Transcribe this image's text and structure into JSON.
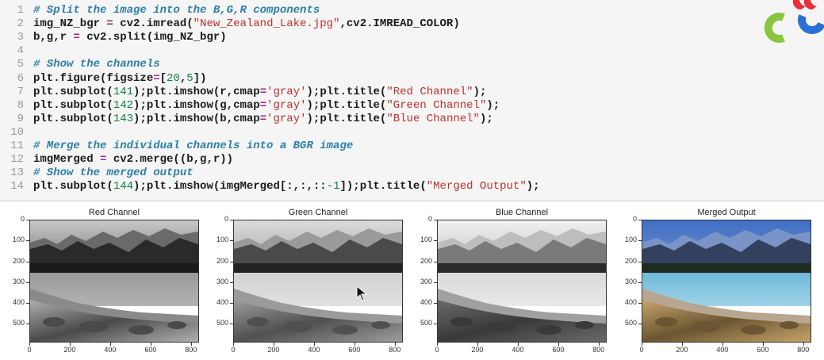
{
  "code_cell": {
    "lines": [
      {
        "n": "1",
        "tokens": [
          {
            "t": "# Split the image into the B,G,R components",
            "c": "comment"
          }
        ]
      },
      {
        "n": "2",
        "tokens": [
          {
            "t": "img_NZ_bgr ",
            "c": "ident"
          },
          {
            "t": "=",
            "c": "op"
          },
          {
            "t": " cv2.imread(",
            "c": "ident"
          },
          {
            "t": "\"New_Zealand_Lake.jpg\"",
            "c": "str"
          },
          {
            "t": ",cv2.IMREAD_COLOR)",
            "c": "ident"
          }
        ]
      },
      {
        "n": "3",
        "tokens": [
          {
            "t": "b,g,r ",
            "c": "ident"
          },
          {
            "t": "=",
            "c": "op"
          },
          {
            "t": " cv2.split(img_NZ_bgr)",
            "c": "ident"
          }
        ]
      },
      {
        "n": "4",
        "tokens": []
      },
      {
        "n": "5",
        "tokens": [
          {
            "t": "# Show the channels",
            "c": "comment"
          }
        ]
      },
      {
        "n": "6",
        "tokens": [
          {
            "t": "plt.figure(figsize",
            "c": "ident"
          },
          {
            "t": "=",
            "c": "op"
          },
          {
            "t": "[",
            "c": "ident"
          },
          {
            "t": "20",
            "c": "num"
          },
          {
            "t": ",",
            "c": "ident"
          },
          {
            "t": "5",
            "c": "num"
          },
          {
            "t": "])",
            "c": "ident"
          }
        ]
      },
      {
        "n": "7",
        "tokens": [
          {
            "t": "plt.subplot(",
            "c": "ident"
          },
          {
            "t": "141",
            "c": "num"
          },
          {
            "t": ");plt.imshow(r,cmap",
            "c": "ident"
          },
          {
            "t": "=",
            "c": "op"
          },
          {
            "t": "'gray'",
            "c": "str"
          },
          {
            "t": ");plt.title(",
            "c": "ident"
          },
          {
            "t": "\"Red Channel\"",
            "c": "str"
          },
          {
            "t": ");",
            "c": "ident"
          }
        ]
      },
      {
        "n": "8",
        "tokens": [
          {
            "t": "plt.subplot(",
            "c": "ident"
          },
          {
            "t": "142",
            "c": "num"
          },
          {
            "t": ");plt.imshow(g,cmap",
            "c": "ident"
          },
          {
            "t": "=",
            "c": "op"
          },
          {
            "t": "'gray'",
            "c": "str"
          },
          {
            "t": ");plt.title(",
            "c": "ident"
          },
          {
            "t": "\"Green Channel\"",
            "c": "str"
          },
          {
            "t": ");",
            "c": "ident"
          }
        ]
      },
      {
        "n": "9",
        "tokens": [
          {
            "t": "plt.subplot(",
            "c": "ident"
          },
          {
            "t": "143",
            "c": "num"
          },
          {
            "t": ");plt.imshow(b,cmap",
            "c": "ident"
          },
          {
            "t": "=",
            "c": "op"
          },
          {
            "t": "'gray'",
            "c": "str"
          },
          {
            "t": ");plt.title(",
            "c": "ident"
          },
          {
            "t": "\"Blue Channel\"",
            "c": "str"
          },
          {
            "t": ");",
            "c": "ident"
          }
        ]
      },
      {
        "n": "10",
        "tokens": []
      },
      {
        "n": "11",
        "tokens": [
          {
            "t": "# Merge the individual channels into a BGR image",
            "c": "comment"
          }
        ]
      },
      {
        "n": "12",
        "tokens": [
          {
            "t": "imgMerged ",
            "c": "ident"
          },
          {
            "t": "=",
            "c": "op"
          },
          {
            "t": " cv2.merge((b,g,r))",
            "c": "ident"
          }
        ]
      },
      {
        "n": "13",
        "tokens": [
          {
            "t": "# Show the merged output",
            "c": "comment"
          }
        ]
      },
      {
        "n": "14",
        "tokens": [
          {
            "t": "plt.subplot(",
            "c": "ident"
          },
          {
            "t": "144",
            "c": "num"
          },
          {
            "t": ");plt.imshow(imgMerged[:,:,::",
            "c": "ident"
          },
          {
            "t": "-1",
            "c": "num"
          },
          {
            "t": "]);plt.title(",
            "c": "ident"
          },
          {
            "t": "\"Merged Output\"",
            "c": "str"
          },
          {
            "t": ");",
            "c": "ident"
          }
        ]
      }
    ]
  },
  "colors": {
    "comment": "#2c7fa8",
    "string": "#b8312f",
    "number": "#108040",
    "operator": "#a0287a",
    "logo_red": "#e8303a",
    "logo_green": "#8ac63f",
    "logo_blue": "#2b6fd6"
  },
  "plots": [
    {
      "title": "Red Channel",
      "mode": "red"
    },
    {
      "title": "Green Channel",
      "mode": "green"
    },
    {
      "title": "Blue Channel",
      "mode": "blue"
    },
    {
      "title": "Merged Output",
      "mode": "color"
    }
  ],
  "axes": {
    "yticks": [
      "0",
      "100",
      "200",
      "300",
      "400",
      "500"
    ],
    "xticks": [
      "0",
      "200",
      "400",
      "600",
      "800"
    ]
  },
  "icons": {
    "logo": "opencv-logo-icon",
    "cursor": "mouse-pointer-icon"
  }
}
